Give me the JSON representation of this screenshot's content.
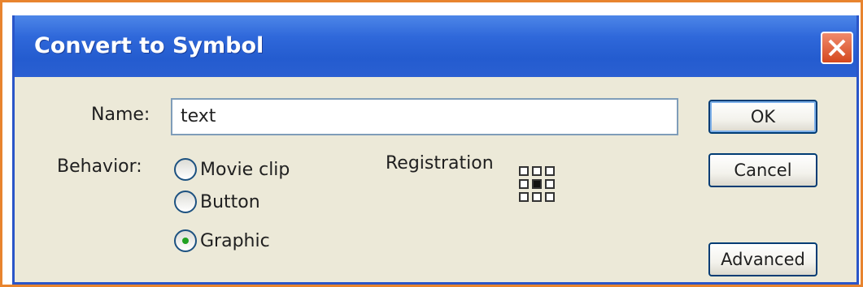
{
  "dialog": {
    "title": "Convert to Symbol",
    "close_icon": "close-icon"
  },
  "name_field": {
    "label": "Name:",
    "value": "text"
  },
  "behavior": {
    "label": "Behavior:",
    "options": [
      {
        "label": "Movie clip",
        "checked": false
      },
      {
        "label": "Button",
        "checked": false
      },
      {
        "label": "Graphic",
        "checked": true
      }
    ]
  },
  "registration": {
    "label": "Registration",
    "selected_cell": "center"
  },
  "buttons": {
    "ok": "OK",
    "cancel": "Cancel",
    "advanced": "Advanced"
  },
  "colors": {
    "titlebar": "#2f68da",
    "close_button": "#d4481e",
    "dialog_bg": "#ece9d8",
    "outer_border": "#e8842e"
  }
}
